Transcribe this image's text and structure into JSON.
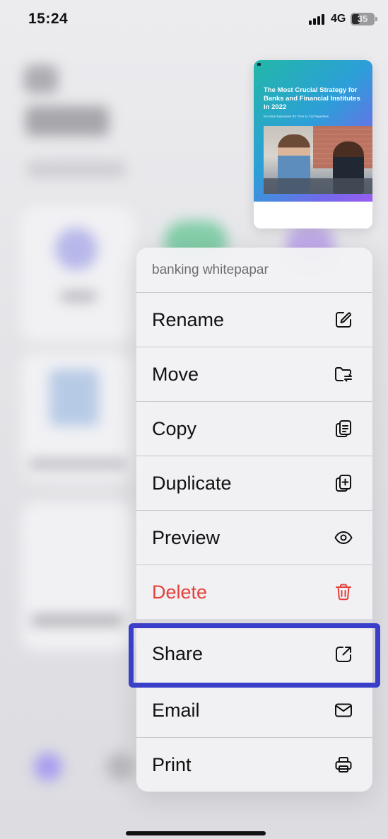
{
  "status_bar": {
    "time": "15:24",
    "network": "4G",
    "battery": "35",
    "battery_level": 0.35
  },
  "preview": {
    "title": "The Most Crucial Strategy for Banks and Financial Institutes in 2022",
    "subtitle": "No More Expenses! It's Time to Cut Paperless"
  },
  "menu": {
    "file_name": "banking whitepapar",
    "items": [
      {
        "label": "Rename",
        "icon": "rename-icon"
      },
      {
        "label": "Move",
        "icon": "move-folder-icon"
      },
      {
        "label": "Copy",
        "icon": "copy-icon"
      },
      {
        "label": "Duplicate",
        "icon": "duplicate-icon"
      },
      {
        "label": "Preview",
        "icon": "eye-icon"
      },
      {
        "label": "Delete",
        "icon": "trash-icon",
        "destructive": true
      },
      {
        "label": "Share",
        "icon": "share-icon",
        "highlighted": true
      },
      {
        "label": "Email",
        "icon": "mail-icon"
      },
      {
        "label": "Print",
        "icon": "printer-icon"
      }
    ]
  },
  "colors": {
    "destructive": "#e5403a",
    "highlight": "#3a3fc9",
    "menu_background": "#f2f2f4"
  }
}
